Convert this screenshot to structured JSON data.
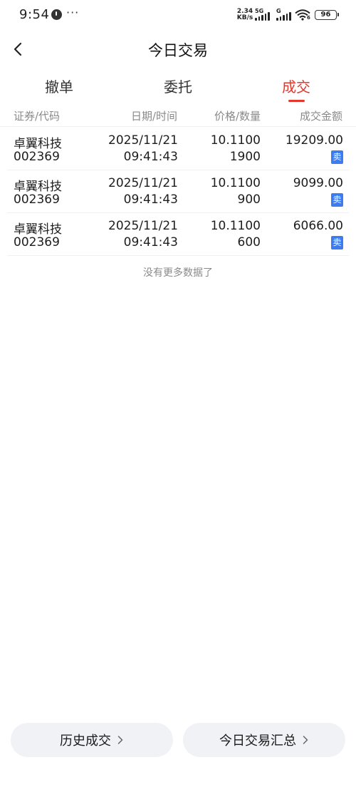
{
  "status_bar": {
    "time": "9:54",
    "more": "···",
    "speed_value": "2.34",
    "speed_unit": "KB/s",
    "signal_1_tag": "5G",
    "signal_2_tag": "G",
    "wifi_tag": "6",
    "battery": "96"
  },
  "header": {
    "title": "今日交易",
    "back_icon": "chevron-left-icon"
  },
  "tabs": [
    {
      "label": "撤单",
      "active": false
    },
    {
      "label": "委托",
      "active": false
    },
    {
      "label": "成交",
      "active": true
    }
  ],
  "table": {
    "headers": [
      "证券/代码",
      "日期/时间",
      "价格/数量",
      "成交金额"
    ],
    "rows": [
      {
        "name": "卓翼科技",
        "code": "002369",
        "date": "2025/11/21",
        "time": "09:41:43",
        "price": "10.1100",
        "quantity": "1900",
        "amount": "19209.00",
        "side": "卖"
      },
      {
        "name": "卓翼科技",
        "code": "002369",
        "date": "2025/11/21",
        "time": "09:41:43",
        "price": "10.1100",
        "quantity": "900",
        "amount": "9099.00",
        "side": "卖"
      },
      {
        "name": "卓翼科技",
        "code": "002369",
        "date": "2025/11/21",
        "time": "09:41:43",
        "price": "10.1100",
        "quantity": "600",
        "amount": "6066.00",
        "side": "卖"
      }
    ],
    "empty_note": "没有更多数据了"
  },
  "bottom": {
    "history_label": "历史成交",
    "summary_label": "今日交易汇总",
    "chevron_icon": "chevron-right-icon"
  },
  "colors": {
    "active_tab": "#e3382e",
    "sell_badge": "#3d7cf0",
    "button_bg": "#f1f2f5"
  }
}
